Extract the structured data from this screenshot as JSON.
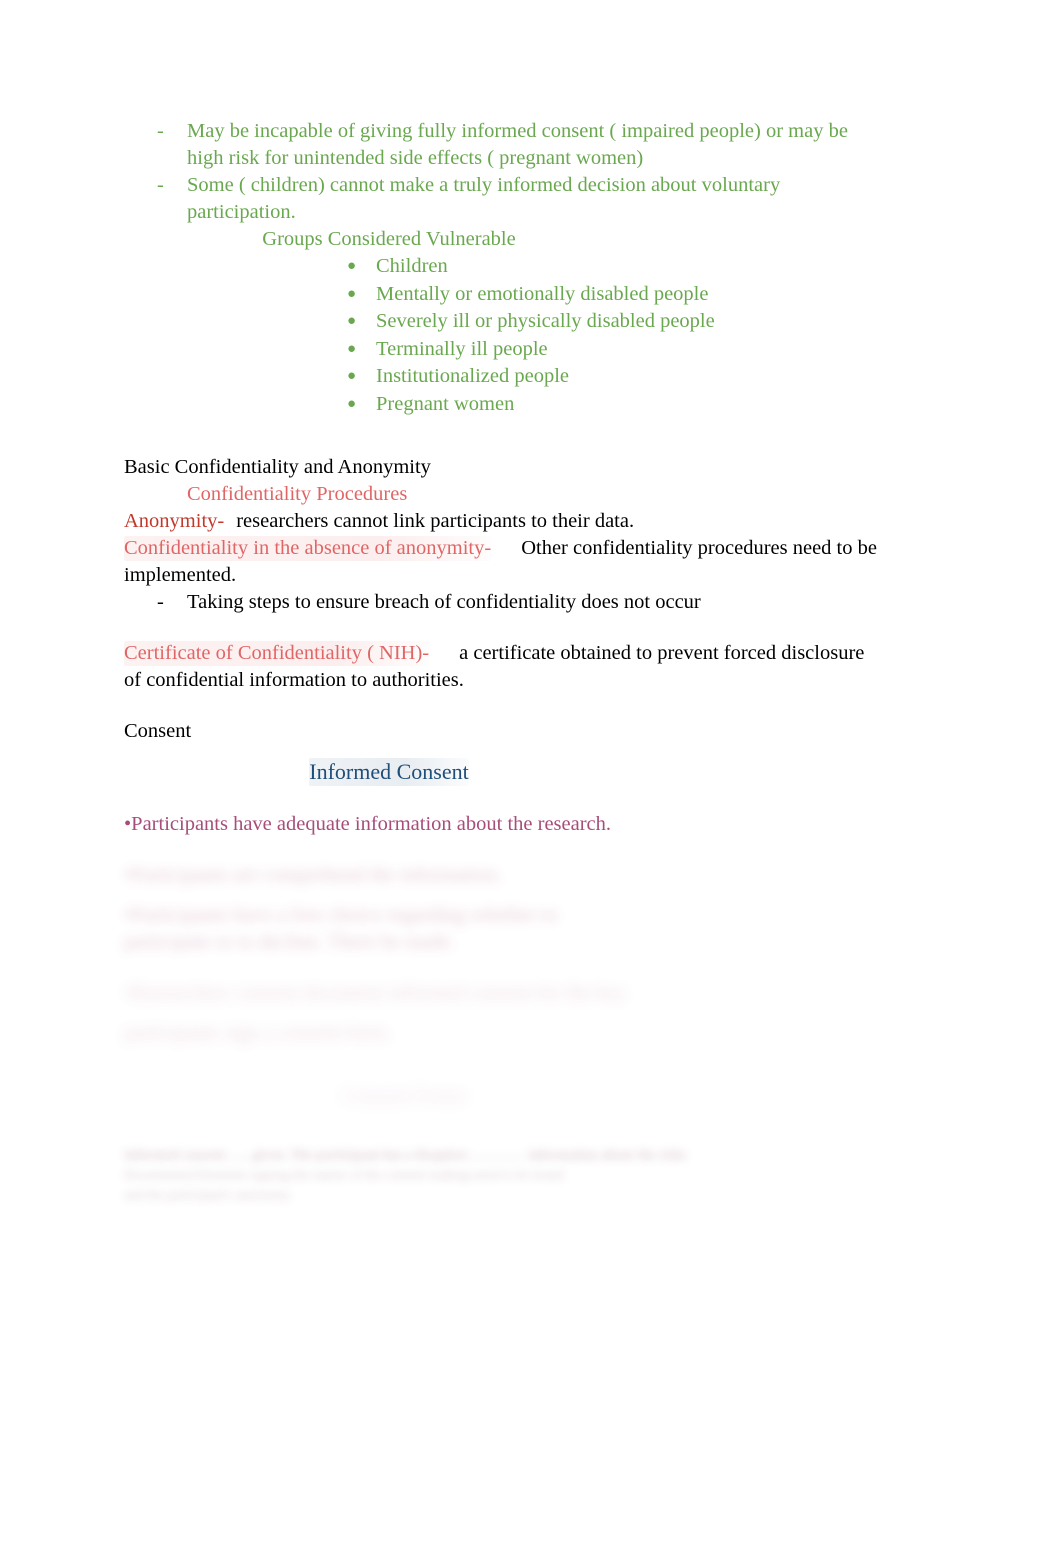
{
  "document": {
    "colors": {
      "green": "#6aa84f",
      "red_strong": "#c0392b",
      "salmon": "#e06666",
      "magenta": "#a64d79",
      "blue": "#1f4e79",
      "black": "#000000",
      "page_background": "#ffffff"
    },
    "vulnerable_section": {
      "dash_items": [
        "May be incapable of giving fully informed consent ( impaired people) or may be high risk for unintended side effects ( pregnant women)",
        "Some ( children) cannot make a truly informed decision about voluntary participation."
      ],
      "groups_heading": "Groups Considered Vulnerable",
      "groups": [
        "Children",
        "Mentally or emotionally disabled people",
        "Severely ill or physically disabled people",
        "Terminally ill people",
        "Institutionalized people",
        "Pregnant women"
      ]
    },
    "confidentiality_section": {
      "heading": "Basic Confidentiality and Anonymity",
      "subheading": "Confidentiality Procedures",
      "anonymity_term": "Anonymity-",
      "anonymity_definition": "researchers cannot link participants to their data.",
      "absence_term": "Confidentiality in the absence of anonymity-",
      "absence_definition": "Other confidentiality procedures need to be implemented.",
      "dash_item": "Taking steps to ensure breach of confidentiality does not occur",
      "certificate_term": "Certificate of Confidentiality ( NIH)-",
      "certificate_definition": "a certificate obtained to prevent forced disclosure of confidential information to authorities."
    },
    "consent_section": {
      "heading": "Consent",
      "informed_consent_title": "Informed Consent",
      "bullet_visible": "•Participants have adequate information about the research.",
      "obscured_lines": [
        "•Participants are comprehend the information.",
        "•Participants have a free choice regarding whether to participate or to decline. There be made.",
        "•Researchers consent document informed consent for the key",
        "participants sign a consent form."
      ],
      "obscured_center": "Consent Forms",
      "obscured_footer": [
        "Informed consent ….. given. The participant has a Requires ………… information about the risks",
        "Documented Elements signing the nature of the consent making need to be found",
        "and the participant's autonomy."
      ]
    }
  }
}
